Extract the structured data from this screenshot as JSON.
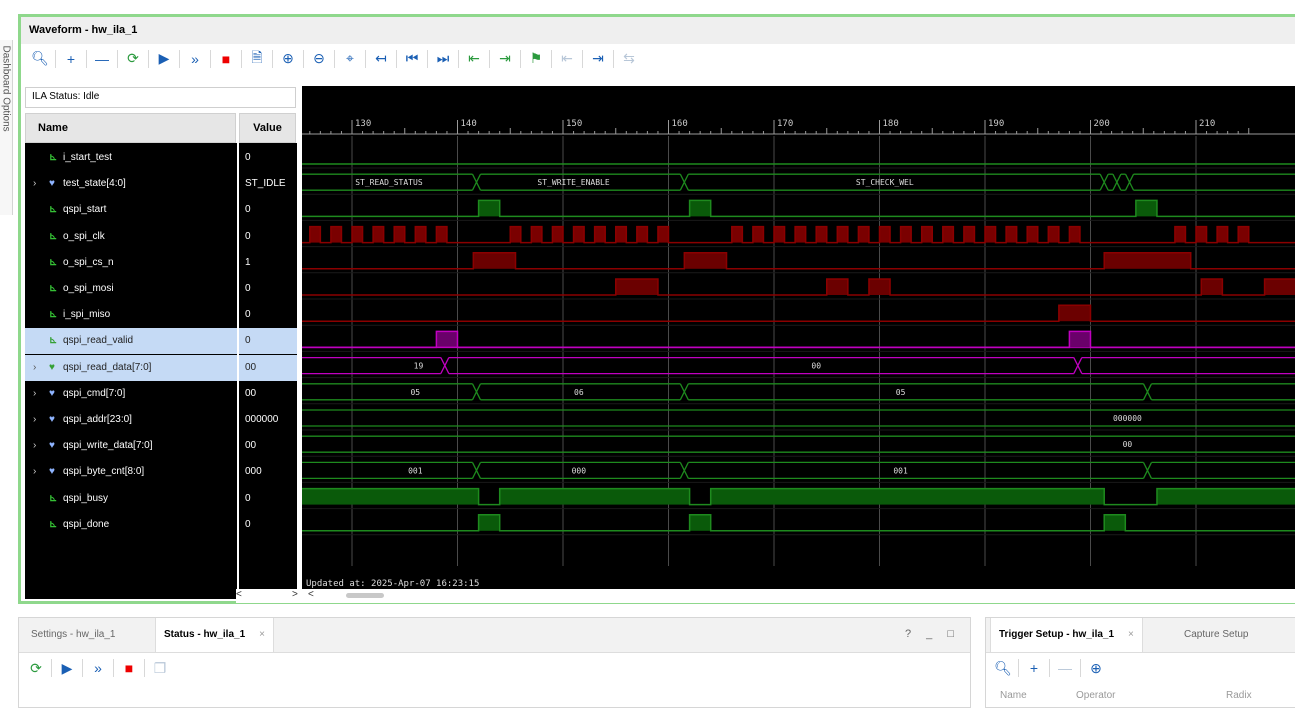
{
  "sidebar": {
    "label": "Dashboard Options"
  },
  "window": {
    "title": "Waveform - hw_ila_1"
  },
  "toolbar": {
    "icons": [
      "search-icon",
      "add-icon",
      "remove-icon",
      "refresh-icon",
      "run-trigger-icon",
      "run-immediate-icon",
      "stop-icon",
      "export-icon",
      "zoom-in-icon",
      "zoom-out-icon",
      "zoom-fit-icon",
      "go-to-cursor-icon",
      "go-to-time-zero-icon",
      "go-to-last-time-icon",
      "previous-transition-icon",
      "next-transition-icon",
      "add-marker-icon",
      "previous-marker-icon",
      "next-marker-icon",
      "swap-cursors-icon"
    ]
  },
  "ila_status": "ILA Status: Idle",
  "table": {
    "name_header": "Name",
    "value_header": "Value"
  },
  "signals": [
    {
      "name": "i_start_test",
      "value": "0",
      "bus": false,
      "expandable": false
    },
    {
      "name": "test_state[4:0]",
      "value": "ST_IDLE",
      "bus": true,
      "expandable": true
    },
    {
      "name": "qspi_start",
      "value": "0",
      "bus": false,
      "expandable": false
    },
    {
      "name": "o_spi_clk",
      "value": "0",
      "bus": false,
      "expandable": false
    },
    {
      "name": "o_spi_cs_n",
      "value": "1",
      "bus": false,
      "expandable": false
    },
    {
      "name": "o_spi_mosi",
      "value": "0",
      "bus": false,
      "expandable": false
    },
    {
      "name": "i_spi_miso",
      "value": "0",
      "bus": false,
      "expandable": false
    },
    {
      "name": "qspi_read_valid",
      "value": "0",
      "bus": false,
      "expandable": false,
      "selected": true
    },
    {
      "name": "qspi_read_data[7:0]",
      "value": "00",
      "bus": true,
      "expandable": true,
      "selected": true
    },
    {
      "name": "qspi_cmd[7:0]",
      "value": "00",
      "bus": true,
      "expandable": true
    },
    {
      "name": "qspi_addr[23:0]",
      "value": "000000",
      "bus": true,
      "expandable": true
    },
    {
      "name": "qspi_write_data[7:0]",
      "value": "00",
      "bus": true,
      "expandable": true
    },
    {
      "name": "qspi_byte_cnt[8:0]",
      "value": "000",
      "bus": true,
      "expandable": true
    },
    {
      "name": "qspi_busy",
      "value": "0",
      "bus": false,
      "expandable": false
    },
    {
      "name": "qspi_done",
      "value": "0",
      "bus": false,
      "expandable": false
    }
  ],
  "timeline": {
    "ticks": [
      "130",
      "140",
      "150",
      "160",
      "170",
      "180",
      "190",
      "200",
      "210"
    ]
  },
  "bus_labels": {
    "test_state": [
      "ST_READ_STATUS",
      "ST_WRITE_ENABLE",
      "ST_CHECK_WEL"
    ],
    "read_data": [
      "19",
      "00"
    ],
    "cmd": [
      "05",
      "06",
      "05"
    ],
    "addr": [
      "000000"
    ],
    "write_data": [
      "00"
    ],
    "byte_cnt": [
      "001",
      "000",
      "001"
    ]
  },
  "updated_at": "Updated at: 2025-Apr-07 16:23:15",
  "scroll": {
    "left": "<",
    "right": ">",
    "left2": "<"
  },
  "bottom_left": {
    "tabs": [
      "Settings - hw_ila_1",
      "Status - hw_ila_1"
    ],
    "active_close": "×",
    "window_controls": "? _ □"
  },
  "bottom_right": {
    "tabs": [
      "Trigger Setup - hw_ila_1",
      "Capture Setup"
    ],
    "active_close": "×",
    "columns": [
      "Name",
      "Operator",
      "Radix"
    ]
  },
  "colors": {
    "wave_green": "#1e8a1e",
    "wave_red": "#8b0000",
    "wave_magenta": "#c000c0",
    "cursor_line": "#bbbbbb",
    "window_border": "#8fd88c"
  }
}
